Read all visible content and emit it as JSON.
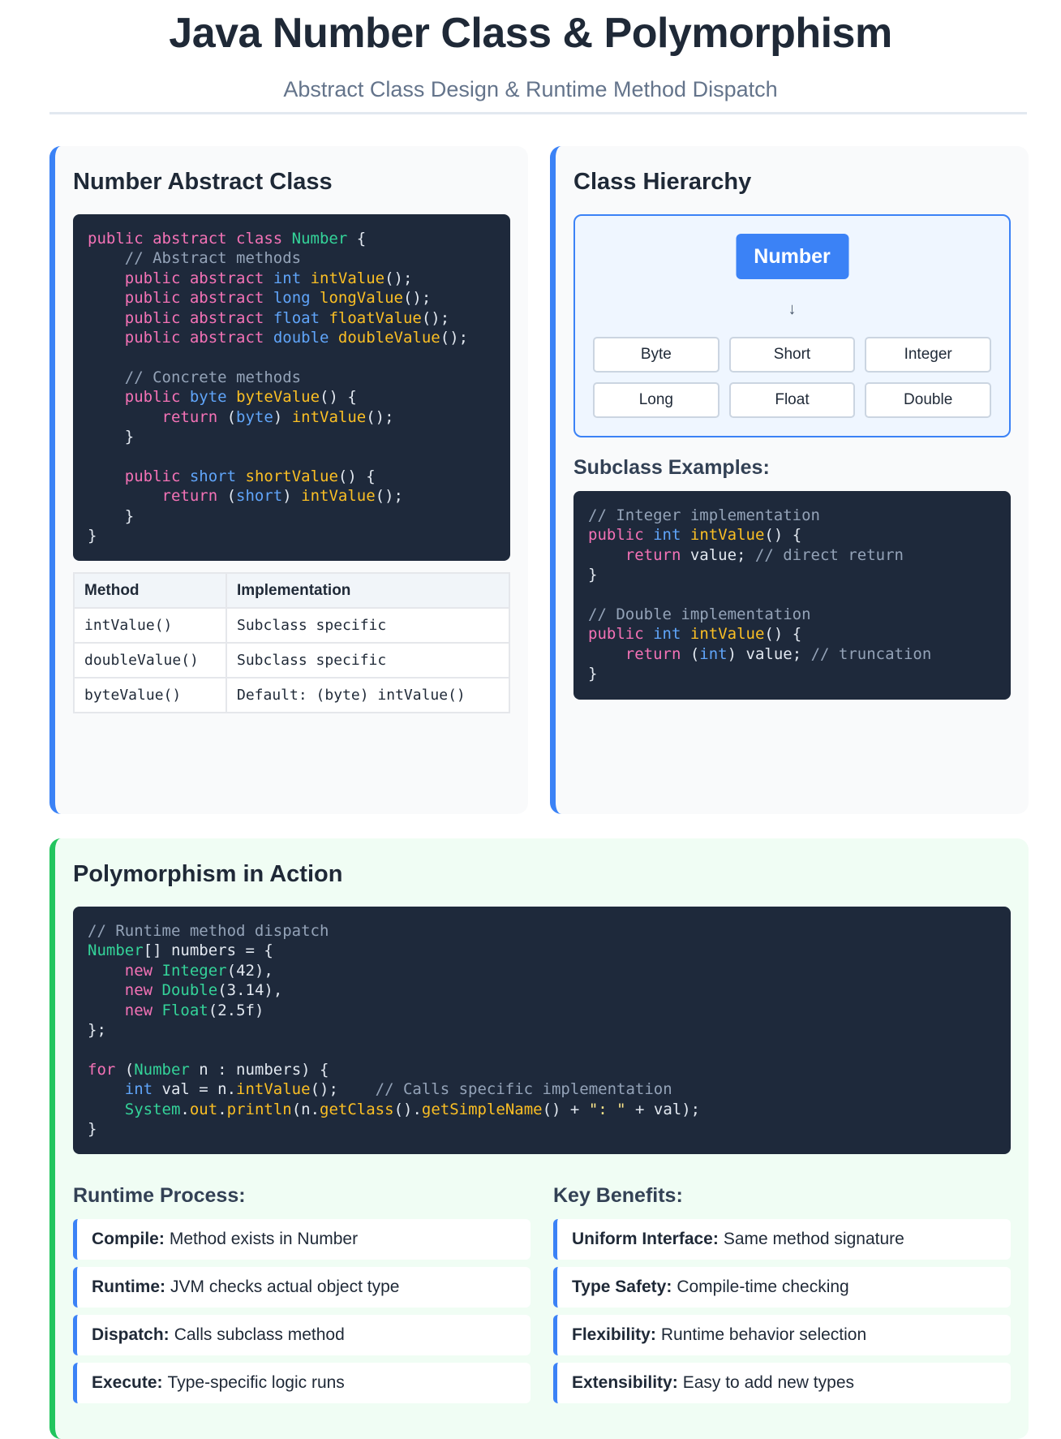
{
  "header": {
    "title": "Java Number Class & Polymorphism",
    "subtitle": "Abstract Class Design & Runtime Method Dispatch"
  },
  "number_class": {
    "title": "Number Abstract Class",
    "table": {
      "headers": [
        "Method",
        "Implementation"
      ],
      "rows": [
        [
          "intValue()",
          "Subclass specific"
        ],
        [
          "doubleValue()",
          "Subclass specific"
        ],
        [
          "byteValue()",
          "Default: (byte) intValue()"
        ]
      ]
    }
  },
  "hierarchy": {
    "title": "Class Hierarchy",
    "root": "Number",
    "arrow": "↓",
    "subclasses": [
      "Byte",
      "Short",
      "Integer",
      "Long",
      "Float",
      "Double"
    ],
    "examples_title": "Subclass Examples:"
  },
  "polymorphism": {
    "title": "Polymorphism in Action",
    "runtime_title": "Runtime Process:",
    "runtime_steps": [
      {
        "label": "Compile:",
        "text": "Method exists in Number"
      },
      {
        "label": "Runtime:",
        "text": "JVM checks actual object type"
      },
      {
        "label": "Dispatch:",
        "text": "Calls subclass method"
      },
      {
        "label": "Execute:",
        "text": "Type-specific logic runs"
      }
    ],
    "benefits_title": "Key Benefits:",
    "benefits": [
      {
        "label": "Uniform Interface:",
        "text": "Same method signature"
      },
      {
        "label": "Type Safety:",
        "text": "Compile-time checking"
      },
      {
        "label": "Flexibility:",
        "text": "Runtime behavior selection"
      },
      {
        "label": "Extensibility:",
        "text": "Easy to add new types"
      }
    ]
  },
  "colors": {
    "accent_blue": "#3b82f6",
    "accent_green": "#22c55e",
    "code_background": "#1e293b",
    "keyword": "#f472b6",
    "type": "#60a5fa",
    "class_name": "#34d399",
    "method": "#fbbf24",
    "comment": "#94a3b8"
  }
}
